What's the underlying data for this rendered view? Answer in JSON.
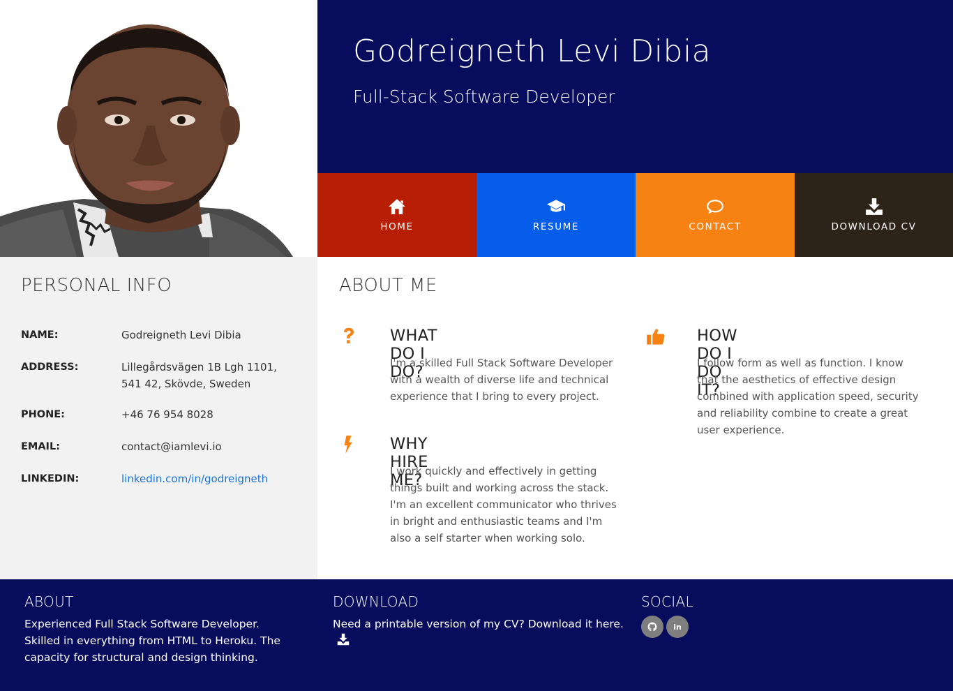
{
  "profile": {
    "name": "Godreigneth Levi Dibia",
    "title": "Full-Stack Software Developer",
    "photo_icon": "profile-photo"
  },
  "nav": [
    {
      "label": "HOME",
      "icon": "home-icon",
      "color": "#b81e04"
    },
    {
      "label": "RESUME",
      "icon": "graduation-cap-icon",
      "color": "#065dea"
    },
    {
      "label": "CONTACT",
      "icon": "speech-bubble-icon",
      "color": "#f68213"
    },
    {
      "label": "DOWNLOAD CV",
      "icon": "download-icon",
      "color": "#2e2318"
    }
  ],
  "personal": {
    "title": "PERSONAL INFO",
    "rows": [
      {
        "label": "NAME:",
        "value": "Godreigneth Levi Dibia"
      },
      {
        "label": "ADDRESS:",
        "value": "Lillegårdsvägen 1B Lgh 1101,",
        "value2": "541 42, Skövde, Sweden"
      },
      {
        "label": "PHONE:",
        "value": "+46 76 954 8028"
      },
      {
        "label": "EMAIL:",
        "value": "contact@iamlevi.io"
      },
      {
        "label": "LINKEDIN:",
        "value": "linkedin.com/in/godreigneth"
      }
    ]
  },
  "about": {
    "title": "ABOUT ME",
    "features": [
      {
        "icon": "question-icon",
        "title": "WHAT DO I DO?",
        "text": "I'm a skilled Full Stack Software Developer with a wealth of diverse life and technical experience that I bring to every project."
      },
      {
        "icon": "thumbs-up-icon",
        "title": "HOW DO I DO IT?",
        "text": "I follow form as well as function. I know that the aesthetics of effective design combined with application speed, security and reliability combine to create a great user experience."
      },
      {
        "icon": "lightning-icon",
        "title": "WHY HIRE ME?",
        "text": "I work quickly and effectively in getting things built and working across the stack. I'm an excellent communicator who thrives in bright and enthusiastic teams and I'm also a self starter when working solo."
      }
    ]
  },
  "footer": {
    "about_title": "ABOUT",
    "about_text": "Experienced Full Stack Software Developer. Skilled in everything from HTML to Heroku. The capacity for structural and design thinking.",
    "download_title": "DOWNLOAD",
    "download_text": "Need a printable version of my CV? Download it here.",
    "social_title": "SOCIAL",
    "social": [
      {
        "icon": "github-icon"
      },
      {
        "icon": "linkedin-icon",
        "label": "in"
      }
    ]
  },
  "colors": {
    "navy": "#070d5c",
    "accent_orange": "#f68213",
    "link_blue": "#1a73d9"
  }
}
